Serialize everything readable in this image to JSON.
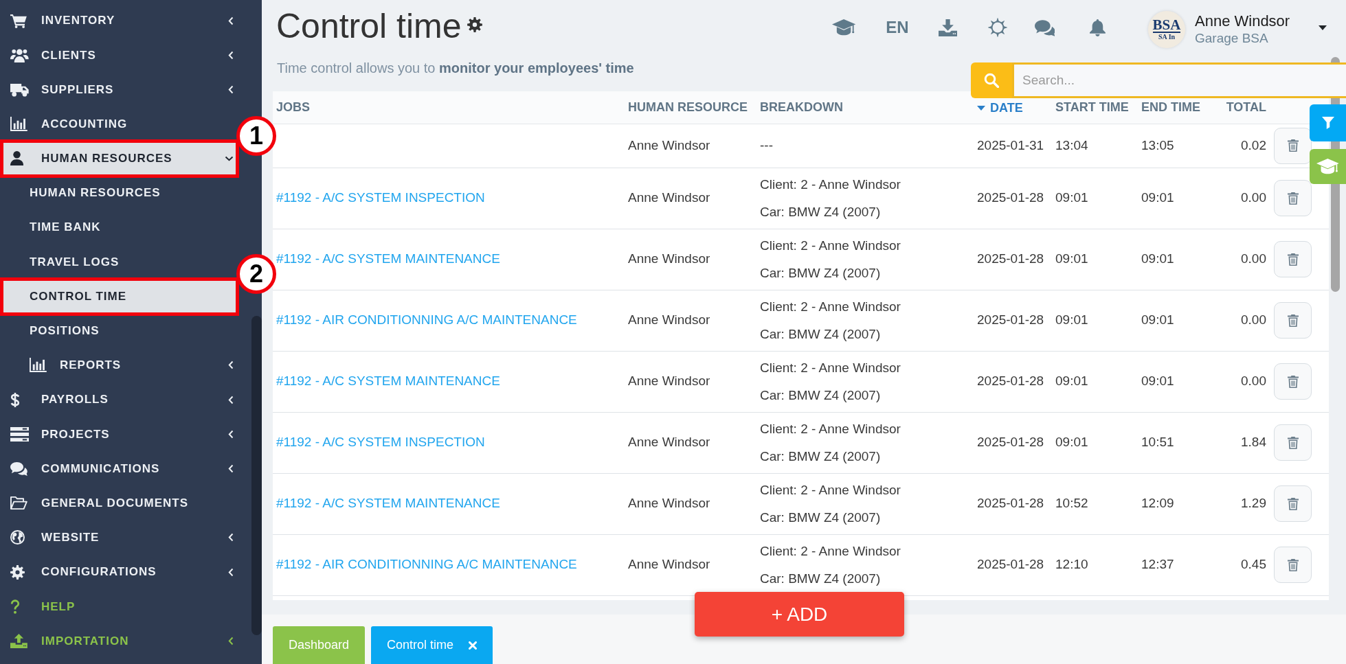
{
  "sidebar": {
    "items": [
      {
        "label": "INVENTORY",
        "selected": false,
        "expanded": false
      },
      {
        "label": "CLIENTS",
        "selected": false,
        "expanded": false
      },
      {
        "label": "SUPPLIERS",
        "selected": false,
        "expanded": false
      },
      {
        "label": "ACCOUNTING",
        "selected": false
      },
      {
        "label": "HUMAN RESOURCES",
        "selected": true,
        "expanded": true,
        "callout": "1",
        "children": [
          {
            "label": "HUMAN RESOURCES",
            "selected": false
          },
          {
            "label": "TIME BANK",
            "selected": false
          },
          {
            "label": "TRAVEL LOGS",
            "selected": false
          },
          {
            "label": "CONTROL TIME",
            "selected": true,
            "callout": "2"
          },
          {
            "label": "POSITIONS",
            "selected": false
          },
          {
            "label": "REPORTS",
            "selected": false,
            "expanded": false
          }
        ]
      },
      {
        "label": "PAYROLLS",
        "selected": false,
        "expanded": false
      },
      {
        "label": "PROJECTS",
        "selected": false,
        "expanded": false
      },
      {
        "label": "COMMUNICATIONS",
        "selected": false,
        "expanded": false
      },
      {
        "label": "GENERAL DOCUMENTS",
        "selected": false
      },
      {
        "label": "WEBSITE",
        "selected": false,
        "expanded": false
      },
      {
        "label": "CONFIGURATIONS",
        "selected": false,
        "expanded": false
      },
      {
        "label": "HELP",
        "selected": false,
        "color": "#8bc34a"
      },
      {
        "label": "IMPORTATION",
        "selected": false,
        "expanded": false,
        "color": "#8bc34a"
      }
    ]
  },
  "header": {
    "title": "Control time",
    "subtitle": "Time control allows you to **monitor your employees' time**",
    "language": "EN",
    "user": {
      "name": "Anne Windsor",
      "company": "Garage BSA",
      "logo_lines": [
        "BSA",
        "SA In"
      ]
    }
  },
  "search": {
    "placeholder": "Search..."
  },
  "table": {
    "columns": [
      {
        "label": "JOBS",
        "sorted": false
      },
      {
        "label": "HUMAN RESOURCE",
        "sorted": false
      },
      {
        "label": "BREAKDOWN",
        "sorted": false
      },
      {
        "label": "DATE",
        "sorted": true
      },
      {
        "label": "START TIME",
        "sorted": false
      },
      {
        "label": "END TIME",
        "sorted": false
      },
      {
        "label": "TOTAL",
        "sorted": false
      }
    ],
    "rows": [
      {
        "human_resource": "Anne Windsor",
        "breakdown": [
          "---"
        ],
        "date": "2025-01-31",
        "start_time": "13:04",
        "end_time": "13:05",
        "total": "0.02"
      },
      {
        "job": "#1192 - A/C SYSTEM INSPECTION",
        "human_resource": "Anne Windsor",
        "breakdown": [
          "Client: 2 - Anne Windsor",
          "Car: BMW Z4 (2007)"
        ],
        "date": "2025-01-28",
        "start_time": "09:01",
        "end_time": "09:01",
        "total": "0.00"
      },
      {
        "job": "#1192 - A/C SYSTEM MAINTENANCE",
        "human_resource": "Anne Windsor",
        "breakdown": [
          "Client: 2 - Anne Windsor",
          "Car: BMW Z4 (2007)"
        ],
        "date": "2025-01-28",
        "start_time": "09:01",
        "end_time": "09:01",
        "total": "0.00"
      },
      {
        "job": "#1192 - AIR CONDITIONNING A/C MAINTENANCE",
        "human_resource": "Anne Windsor",
        "breakdown": [
          "Client: 2 - Anne Windsor",
          "Car: BMW Z4 (2007)"
        ],
        "date": "2025-01-28",
        "start_time": "09:01",
        "end_time": "09:01",
        "total": "0.00"
      },
      {
        "job": "#1192 - A/C SYSTEM MAINTENANCE",
        "human_resource": "Anne Windsor",
        "breakdown": [
          "Client: 2 - Anne Windsor",
          "Car: BMW Z4 (2007)"
        ],
        "date": "2025-01-28",
        "start_time": "09:01",
        "end_time": "09:01",
        "total": "0.00"
      },
      {
        "job": "#1192 - A/C SYSTEM INSPECTION",
        "human_resource": "Anne Windsor",
        "breakdown": [
          "Client: 2 - Anne Windsor",
          "Car: BMW Z4 (2007)"
        ],
        "date": "2025-01-28",
        "start_time": "09:01",
        "end_time": "10:51",
        "total": "1.84"
      },
      {
        "job": "#1192 - A/C SYSTEM MAINTENANCE",
        "human_resource": "Anne Windsor",
        "breakdown": [
          "Client: 2 - Anne Windsor",
          "Car: BMW Z4 (2007)"
        ],
        "date": "2025-01-28",
        "start_time": "10:52",
        "end_time": "12:09",
        "total": "1.29"
      },
      {
        "job": "#1192 - AIR CONDITIONNING A/C MAINTENANCE",
        "human_resource": "Anne Windsor",
        "breakdown": [
          "Client: 2 - Anne Windsor",
          "Car: BMW Z4 (2007)"
        ],
        "date": "2025-01-28",
        "start_time": "12:10",
        "end_time": "12:37",
        "total": "0.45"
      }
    ]
  },
  "add_button": {
    "label": "+ ADD"
  },
  "bottom_tabs": [
    {
      "label": "Dashboard",
      "selected": false,
      "closable": false
    },
    {
      "label": "Control time",
      "selected": true,
      "closable": true
    }
  ]
}
